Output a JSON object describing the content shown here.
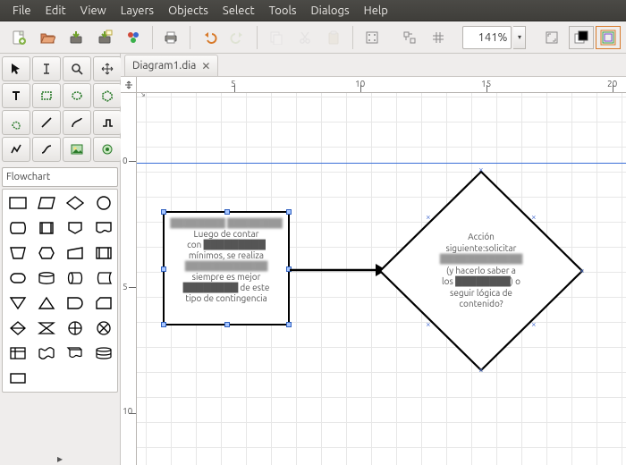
{
  "menu": {
    "items": [
      "File",
      "Edit",
      "View",
      "Layers",
      "Objects",
      "Select",
      "Tools",
      "Dialogs",
      "Help"
    ]
  },
  "toolbar": {
    "zoom": "141%"
  },
  "document": {
    "tab_label": "Diagram1.dia"
  },
  "palette": {
    "category": "Flowchart"
  },
  "ruler": {
    "h": [
      {
        "pos": 109,
        "label": "5"
      },
      {
        "pos": 250,
        "label": "10"
      },
      {
        "pos": 391,
        "label": "15"
      },
      {
        "pos": 532,
        "label": "20"
      }
    ],
    "v": [
      {
        "pos": 76,
        "label": "0"
      },
      {
        "pos": 217,
        "label": "5"
      },
      {
        "pos": 358,
        "label": "10"
      }
    ]
  },
  "shapes": {
    "box": {
      "lines": [
        "████████ ████████",
        "Luego de contar",
        "con █████████",
        "mínimos, se realiza",
        "████████████",
        "siempre es mejor",
        "████████ de este",
        "tipo de contingencia"
      ]
    },
    "diamond": {
      "lines": [
        "Acción",
        "siguiente:solicitar",
        "████████████",
        "(y hacerlo saber a",
        "los ████████) o",
        "seguir lógica de",
        "contenido?"
      ]
    }
  }
}
